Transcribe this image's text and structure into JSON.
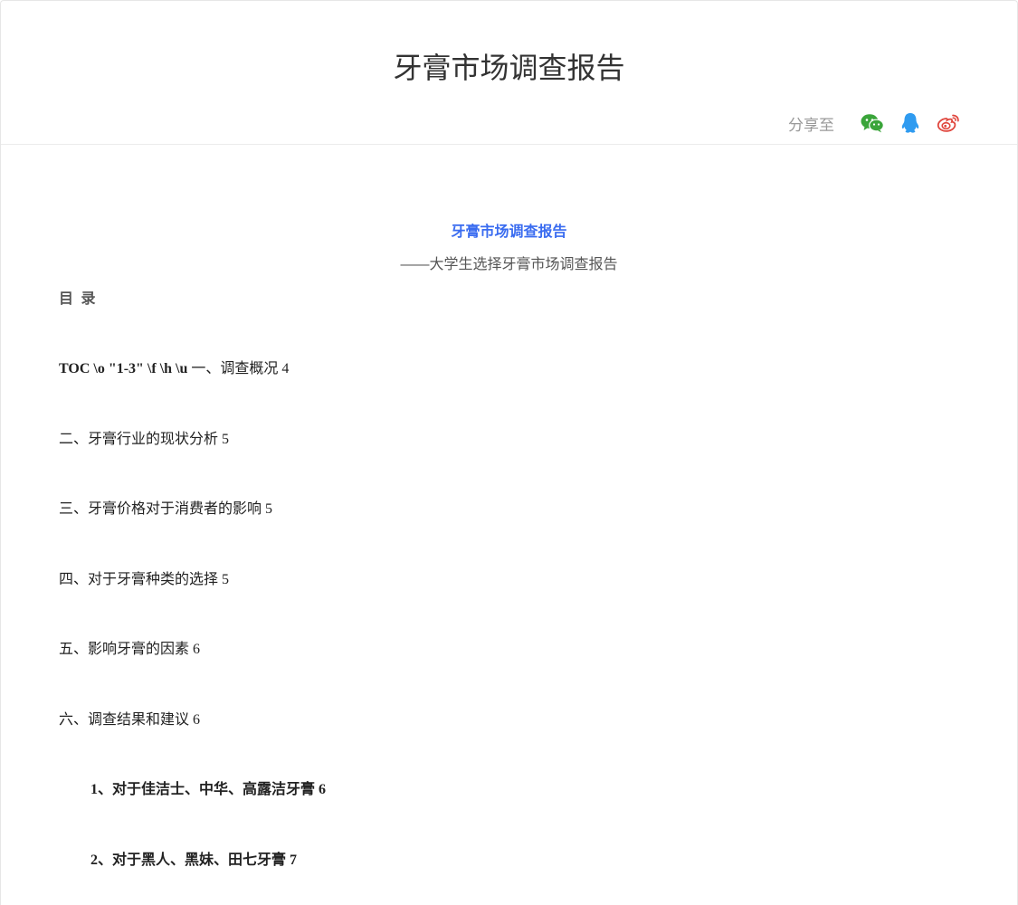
{
  "header": {
    "title": "牙膏市场调查报告",
    "share_label": "分享至",
    "share_icons": [
      "wechat-icon",
      "qq-icon",
      "weibo-icon"
    ],
    "colors": {
      "wechat": "#3aa53a",
      "qq": "#2f9bf0",
      "weibo": "#e0463d"
    }
  },
  "content": {
    "title": "牙膏市场调查报告",
    "subtitle": "——大学生选择牙膏市场调查报告",
    "toc_heading": "目 录",
    "toc_prefix": "TOC \\o \"1-3\" \\f \\h \\u ",
    "toc_items": [
      "一、调查概况 4",
      "二、牙膏行业的现状分析 5",
      "三、牙膏价格对于消费者的影响 5",
      "四、对于牙膏种类的选择 5",
      "五、影响牙膏的因素 6",
      "六、调查结果和建议 6",
      "1、对于佳洁士、中华、高露洁牙膏 6",
      "2、对于黑人、黑妹、田七牙膏 7"
    ]
  }
}
